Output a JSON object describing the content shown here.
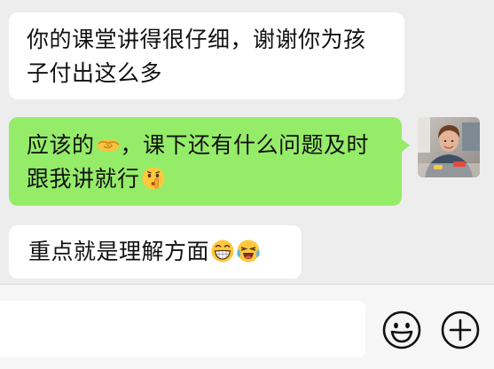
{
  "messages": [
    {
      "id": "msg1",
      "side": "left",
      "line1": "你的课堂讲得很仔细，谢谢你为孩",
      "line2": "子付出这么多"
    },
    {
      "id": "msg2",
      "side": "right",
      "line1_a": "应该的",
      "line1_b": "，课下还有什么问题及时",
      "line2": "跟我讲就行",
      "emojis": [
        "handshake-emoji",
        "shushing-face-emoji"
      ]
    },
    {
      "id": "msg3",
      "side": "left",
      "text": "重点就是理解方面",
      "emojis": [
        "grinning-face-emoji",
        "loudly-crying-laughing-emoji"
      ]
    }
  ],
  "input": {
    "value": "",
    "placeholder": ""
  },
  "icons": {
    "emoji_button": "smiley-face-icon",
    "plus_button": "plus-circle-icon"
  },
  "colors": {
    "chat_background": "#ededed",
    "outgoing_bubble": "#95ec69",
    "incoming_bubble": "#ffffff"
  }
}
